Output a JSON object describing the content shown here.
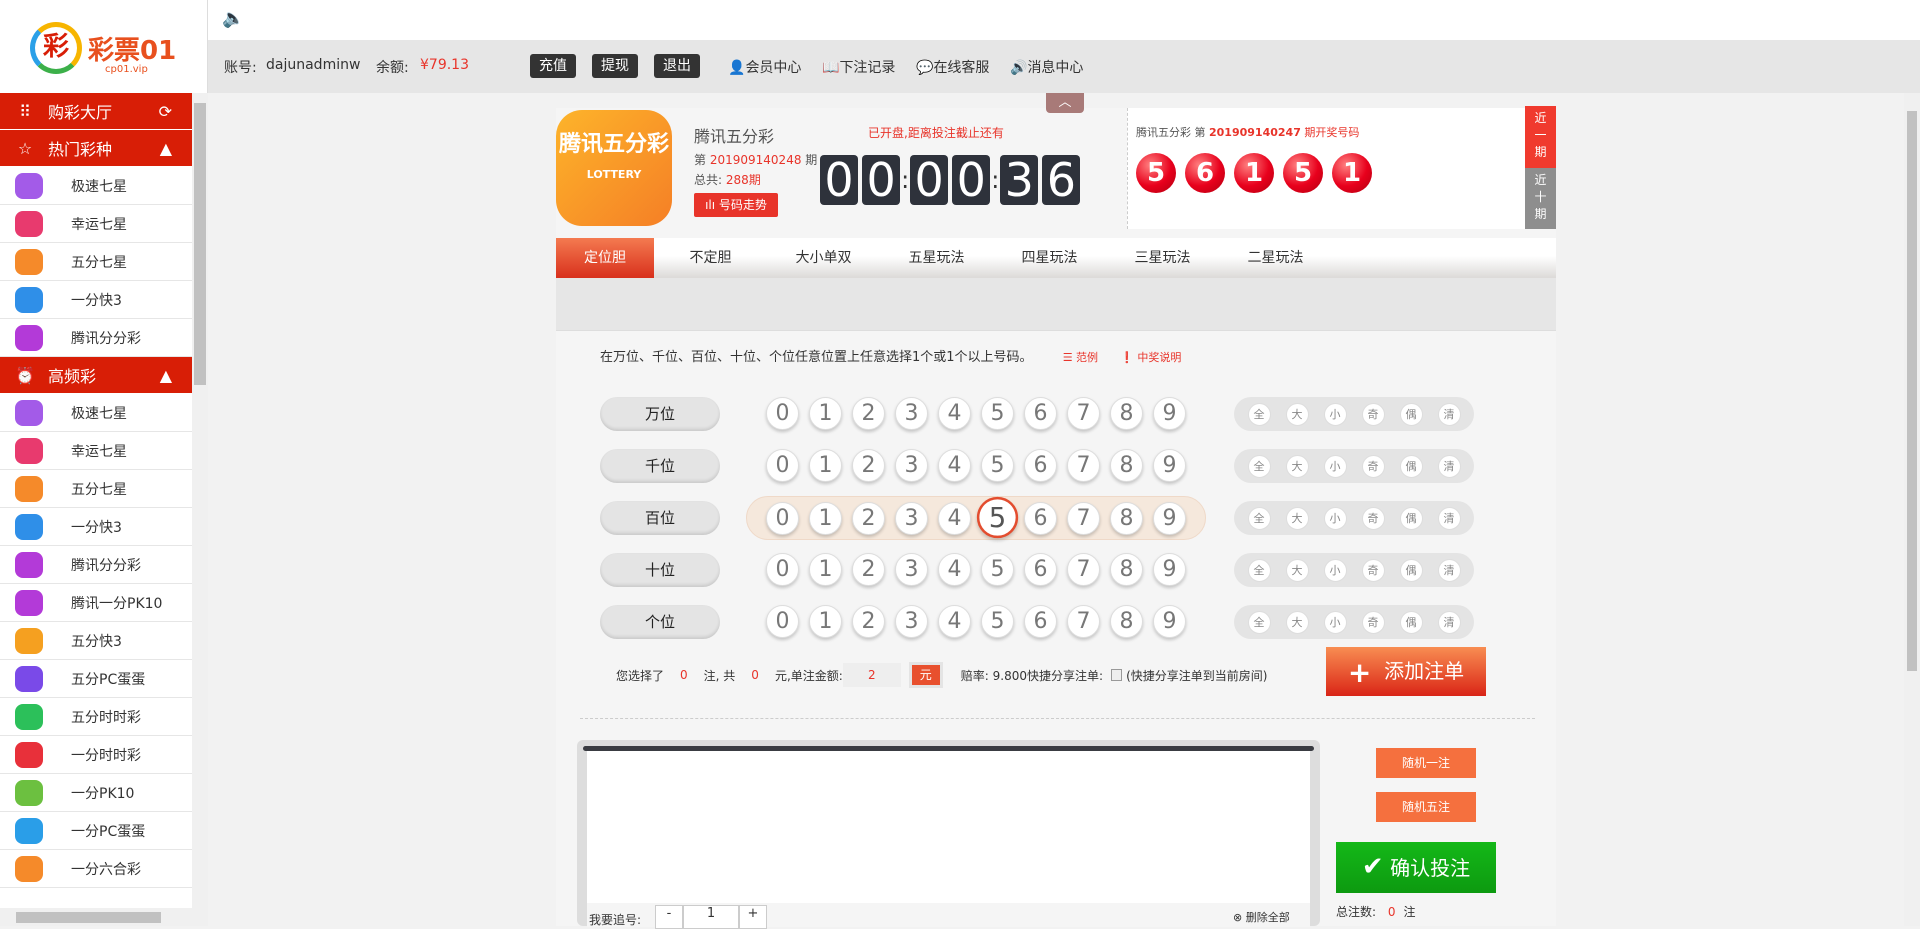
{
  "brand": {
    "logo_text": "彩票01",
    "logo_sub": "cp01.vip"
  },
  "header": {
    "account_label": "账号:",
    "account": "dajunadminw",
    "balance_label": "余额:",
    "balance": "¥79.13",
    "buttons": [
      "充值",
      "提现",
      "退出"
    ],
    "links": [
      "会员中心",
      "下注记录",
      "在线客服",
      "消息中心"
    ]
  },
  "sidebar": {
    "lobby": "购彩大厅",
    "hot": {
      "title": "热门彩种",
      "items": [
        {
          "label": "极速七星",
          "color": "#a35be8"
        },
        {
          "label": "幸运七星",
          "color": "#e83a6e"
        },
        {
          "label": "五分七星",
          "color": "#f58a2a"
        },
        {
          "label": "一分快3",
          "color": "#2f8fe8"
        },
        {
          "label": "腾讯分分彩",
          "color": "#b33ad8"
        }
      ]
    },
    "freq": {
      "title": "高频彩",
      "items": [
        {
          "label": "极速七星",
          "color": "#a35be8"
        },
        {
          "label": "幸运七星",
          "color": "#e83a6e"
        },
        {
          "label": "五分七星",
          "color": "#f58a2a"
        },
        {
          "label": "一分快3",
          "color": "#2f8fe8"
        },
        {
          "label": "腾讯分分彩",
          "color": "#b33ad8"
        },
        {
          "label": "腾讯一分PK10",
          "color": "#b33ad8"
        },
        {
          "label": "五分快3",
          "color": "#f5a020"
        },
        {
          "label": "五分PC蛋蛋",
          "color": "#7a4ae8"
        },
        {
          "label": "五分时时彩",
          "color": "#2cc05a"
        },
        {
          "label": "一分时时彩",
          "color": "#e8303a"
        },
        {
          "label": "一分PK10",
          "color": "#6cc040"
        },
        {
          "label": "一分PC蛋蛋",
          "color": "#2a9ee8"
        },
        {
          "label": "一分六合彩",
          "color": "#f58a2a"
        }
      ]
    }
  },
  "game": {
    "name": "腾讯五分彩",
    "logo_text": "腾讯五分彩",
    "logo_sub": "LOTTERY",
    "issue_prefix": "第",
    "issue": "201909140248",
    "issue_suffix": "期",
    "total_label": "总共:",
    "total": "288期",
    "trend_button": "号码走势",
    "status": "已开盘,距离投注截止还有",
    "countdown": [
      "0",
      "0",
      "0",
      "0",
      "3",
      "6"
    ]
  },
  "last_draw": {
    "prefix": "腾讯五分彩 第",
    "issue": "201909140247",
    "suffix": "期开奖号码",
    "numbers": [
      "5",
      "6",
      "1",
      "5",
      "1"
    ],
    "tabs": [
      "近一期",
      "近十期"
    ]
  },
  "tabs": [
    "定位胆",
    "不定胆",
    "大小单双",
    "五星玩法",
    "四星玩法",
    "三星玩法",
    "二星玩法"
  ],
  "instruction": "在万位、千位、百位、十位、个位任意位置上任意选择1个或1个以上号码。",
  "example": "范例",
  "prize_info": "中奖说明",
  "rows": [
    {
      "label": "万位",
      "selected": null
    },
    {
      "label": "千位",
      "selected": null
    },
    {
      "label": "百位",
      "selected": 5
    },
    {
      "label": "十位",
      "selected": null
    },
    {
      "label": "个位",
      "selected": null
    }
  ],
  "digits": [
    "0",
    "1",
    "2",
    "3",
    "4",
    "5",
    "6",
    "7",
    "8",
    "9"
  ],
  "quick": [
    "全",
    "大",
    "小",
    "奇",
    "偶",
    "清"
  ],
  "summary": {
    "t1": "您选择了",
    "count": "0",
    "t2": "注, 共",
    "total": "0",
    "t3": "元,单注金额:",
    "amount": "2",
    "unit": "元",
    "odds": "赔率: 9.800",
    "share": "快捷分享注单:",
    "share_note": "(快捷分享注单到当前房间)"
  },
  "add_button": "添加注单",
  "random1": "随机一注",
  "random5": "随机五注",
  "confirm": "确认投注",
  "total_bets_label": "总注数:",
  "total_bets": "0",
  "total_bets_unit": "注",
  "chase": {
    "label": "我要追号:",
    "minus": "-",
    "value": "1",
    "plus": "+"
  },
  "delete_all": "删除全部"
}
